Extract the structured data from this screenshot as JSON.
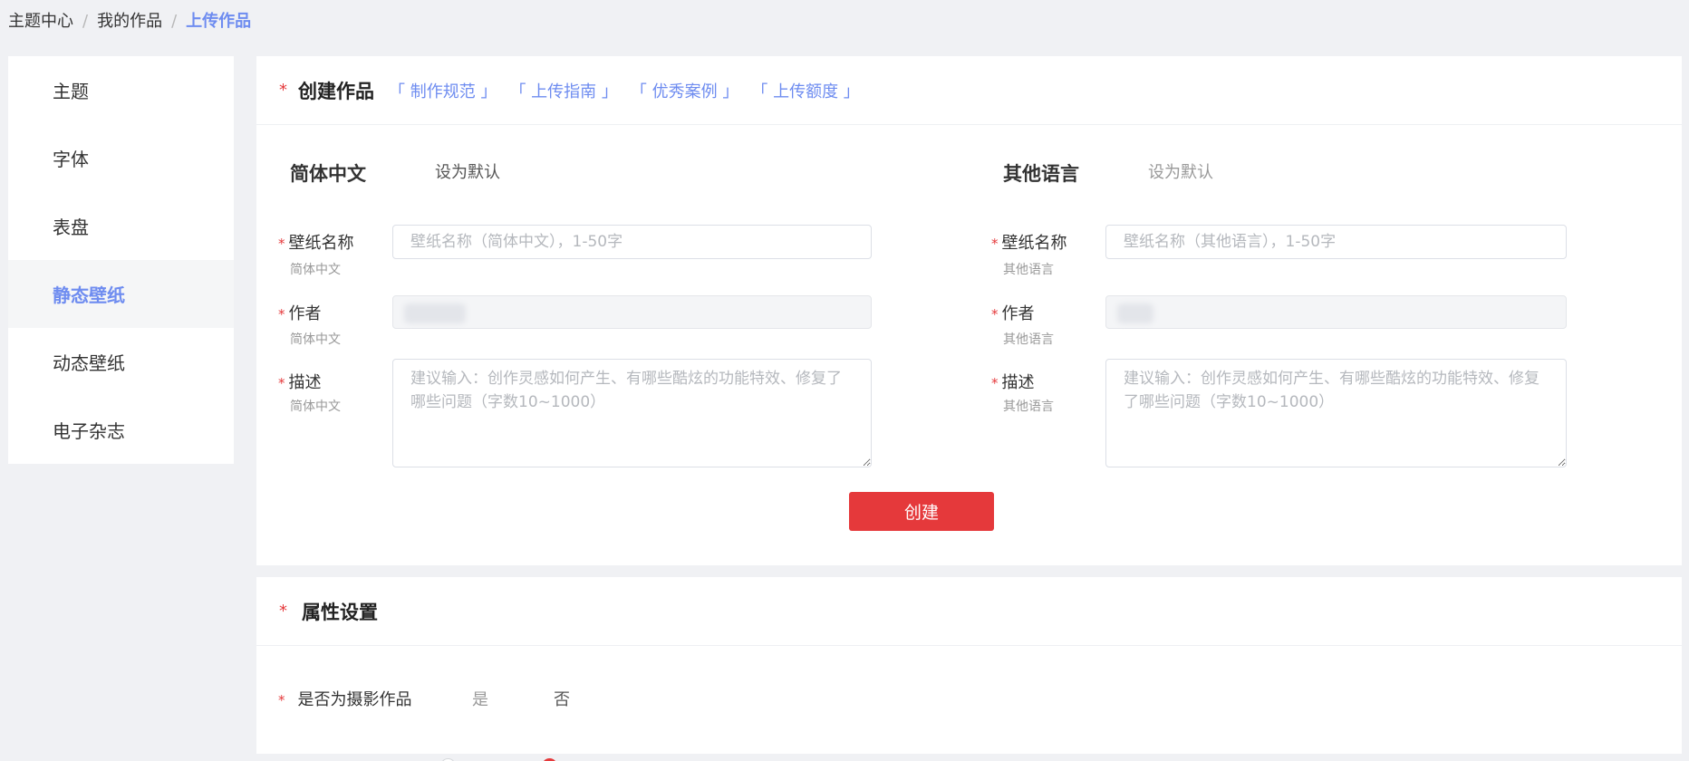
{
  "breadcrumb": {
    "items": [
      "主题中心",
      "我的作品"
    ],
    "separator": "/",
    "current": "上传作品"
  },
  "sidebar": {
    "items": [
      {
        "label": "主题"
      },
      {
        "label": "字体"
      },
      {
        "label": "表盘"
      },
      {
        "label": "静态壁纸",
        "active": true
      },
      {
        "label": "动态壁纸"
      },
      {
        "label": "电子杂志"
      }
    ]
  },
  "create_panel": {
    "required_mark": "*",
    "title": "创建作品",
    "links": [
      "「 制作规范 」",
      "「 上传指南 」",
      "「 优秀案例 」",
      "「 上传额度 」"
    ],
    "left": {
      "lang_title": "简体中文",
      "default_label": "设为默认",
      "default_selected": true,
      "name_label": "壁纸名称",
      "name_sub": "简体中文",
      "name_placeholder": "壁纸名称（简体中文），1-50字",
      "author_label": "作者",
      "author_sub": "简体中文",
      "desc_label": "描述",
      "desc_sub": "简体中文",
      "desc_placeholder": "建议输入：创作灵感如何产生、有哪些酷炫的功能特效、修复了哪些问题（字数10~1000）"
    },
    "right": {
      "lang_title": "其他语言",
      "default_label": "设为默认",
      "default_selected": false,
      "name_label": "壁纸名称",
      "name_sub": "其他语言",
      "name_placeholder": "壁纸名称（其他语言），1-50字",
      "author_label": "作者",
      "author_sub": "其他语言",
      "desc_label": "描述",
      "desc_sub": "其他语言",
      "desc_placeholder": "建议输入：创作灵感如何产生、有哪些酷炫的功能特效、修复了哪些问题（字数10~1000）"
    },
    "create_button": "创建"
  },
  "attr_panel": {
    "required_mark": "*",
    "title": "属性设置",
    "photo_question": "是否为摄影作品",
    "options": [
      {
        "label": "是",
        "selected": false
      },
      {
        "label": "否",
        "selected": true
      }
    ]
  },
  "colors": {
    "accent_red": "#e5393b",
    "link_blue": "#6e8cf0",
    "page_bg": "#f0f1f4"
  }
}
